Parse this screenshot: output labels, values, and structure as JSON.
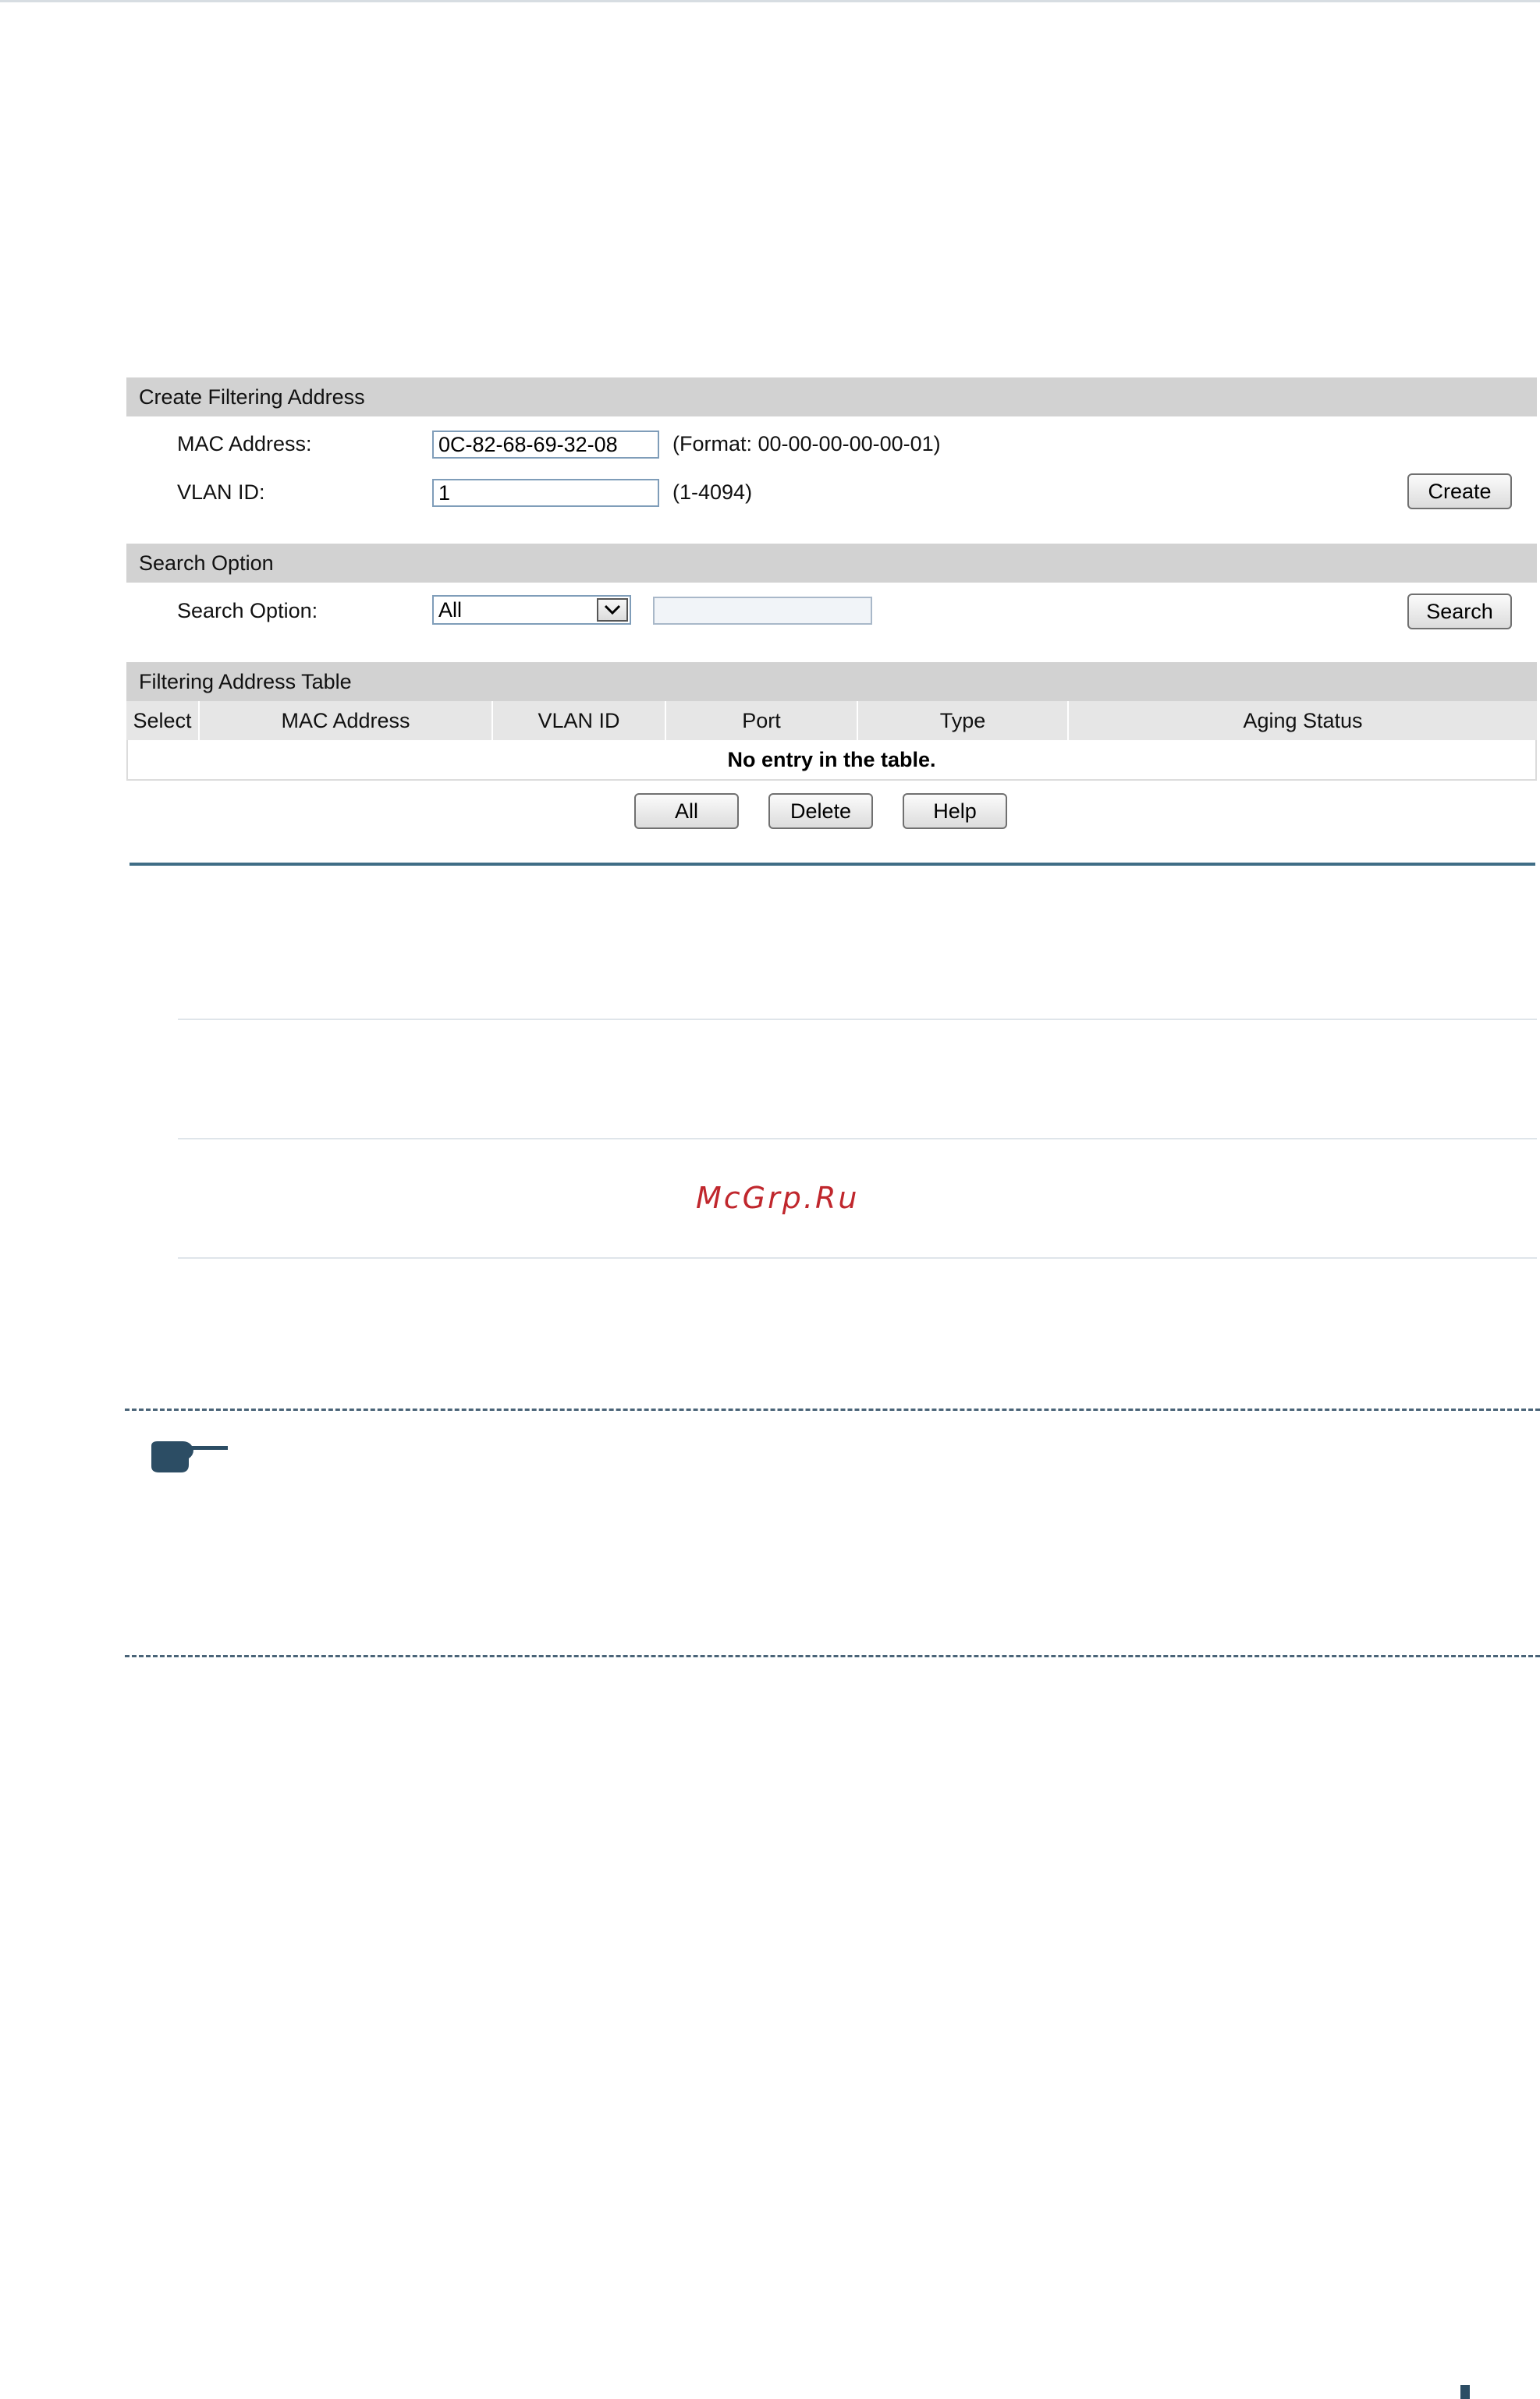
{
  "create_section": {
    "header": "Create Filtering Address",
    "mac_label": "MAC Address:",
    "mac_value": "0C-82-68-69-32-08",
    "mac_hint": "(Format: 00-00-00-00-00-01)",
    "vlan_label": "VLAN ID:",
    "vlan_value": "1",
    "vlan_hint": "(1-4094)",
    "create_button": "Create"
  },
  "search_section": {
    "header": "Search Option",
    "label": "Search Option:",
    "selected_option": "All",
    "search_value": "",
    "search_button": "Search"
  },
  "table_section": {
    "header": "Filtering Address Table",
    "columns": [
      "Select",
      "MAC Address",
      "VLAN ID",
      "Port",
      "Type",
      "Aging Status"
    ],
    "empty_message": "No entry in the table."
  },
  "actions": {
    "all_button": "All",
    "delete_button": "Delete",
    "help_button": "Help"
  },
  "watermark": "McGrp.Ru",
  "icons": {
    "note": "pointing-hand-icon",
    "dropdown": "chevron-down-icon"
  },
  "colors": {
    "section_header_bg": "#d2d2d2",
    "rule_dark": "#3f6d86",
    "watermark": "#c0272d"
  }
}
